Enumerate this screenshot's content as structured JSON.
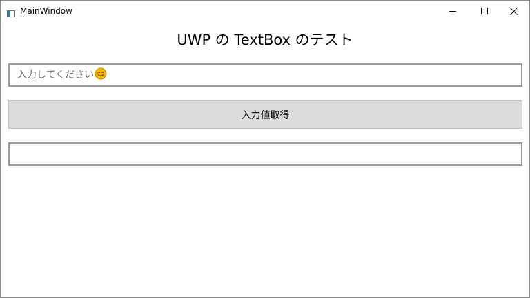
{
  "window": {
    "title": "MainWindow"
  },
  "heading": {
    "text": "UWP の TextBox のテスト"
  },
  "input": {
    "placeholder": "入力してください",
    "placeholder_icon": "smiling-face-emoji",
    "value": ""
  },
  "action_button": {
    "label": "入力値取得"
  },
  "output": {
    "value": ""
  },
  "icons": {
    "app": "window-icon",
    "minimize": "minimize-icon",
    "maximize": "maximize-icon",
    "close": "close-icon"
  },
  "colors": {
    "button_background": "#dcdcdc",
    "textbox_border": "#9a9a9a",
    "placeholder_text": "#6e6e6e",
    "emoji_face": "#f5b800"
  }
}
